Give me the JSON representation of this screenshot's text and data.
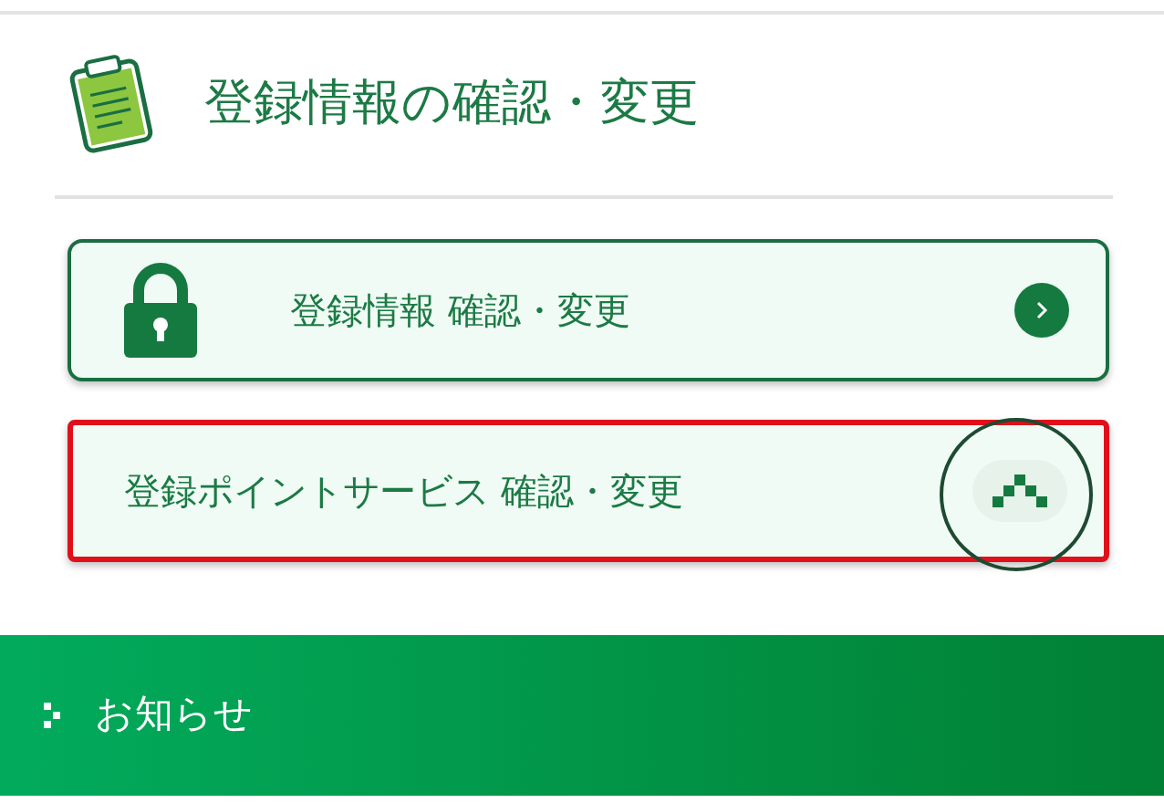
{
  "section": {
    "title": "登録情報の確認・変更"
  },
  "items": [
    {
      "label": "登録情報 確認・変更",
      "kind": "link",
      "highlighted": false
    },
    {
      "label": "登録ポイントサービス 確認・変更",
      "kind": "accordion",
      "highlighted": true,
      "expanded": true
    }
  ],
  "footer": {
    "label": "お知らせ"
  }
}
